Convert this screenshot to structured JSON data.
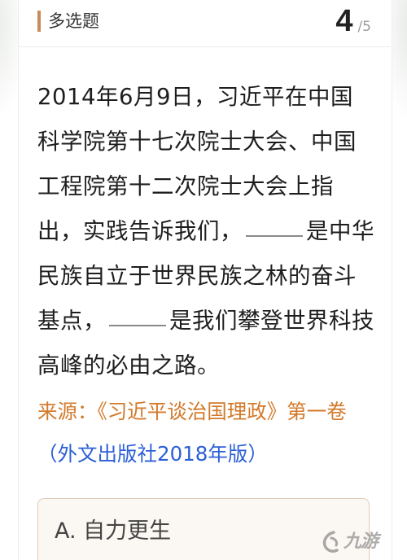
{
  "header": {
    "question_type": "多选题",
    "progress_current": "4",
    "progress_total": "/5"
  },
  "question": {
    "segment_1": "2014年6月9日，习近平在中国科学院第十七次院士大会、中国工程院第十二次院士大会上指出，实践告诉我们，",
    "segment_2": "是中华民族自立于世界民族之林的奋斗基点，",
    "segment_3": "是我们攀登世界科技高峰的必由之路。"
  },
  "source": {
    "label": "来源：",
    "book": "《习近平谈治国理政》第一卷",
    "publisher": "（外文出版社2018年版）"
  },
  "options": [
    {
      "label": "A. 自力更生"
    }
  ],
  "watermark": {
    "text": "九游",
    "icon": "jiuyou-logo-icon"
  },
  "colors": {
    "accent_orange": "#d37a2b",
    "link_blue": "#2c5fd6",
    "bar_brown": "#c98b5a"
  }
}
